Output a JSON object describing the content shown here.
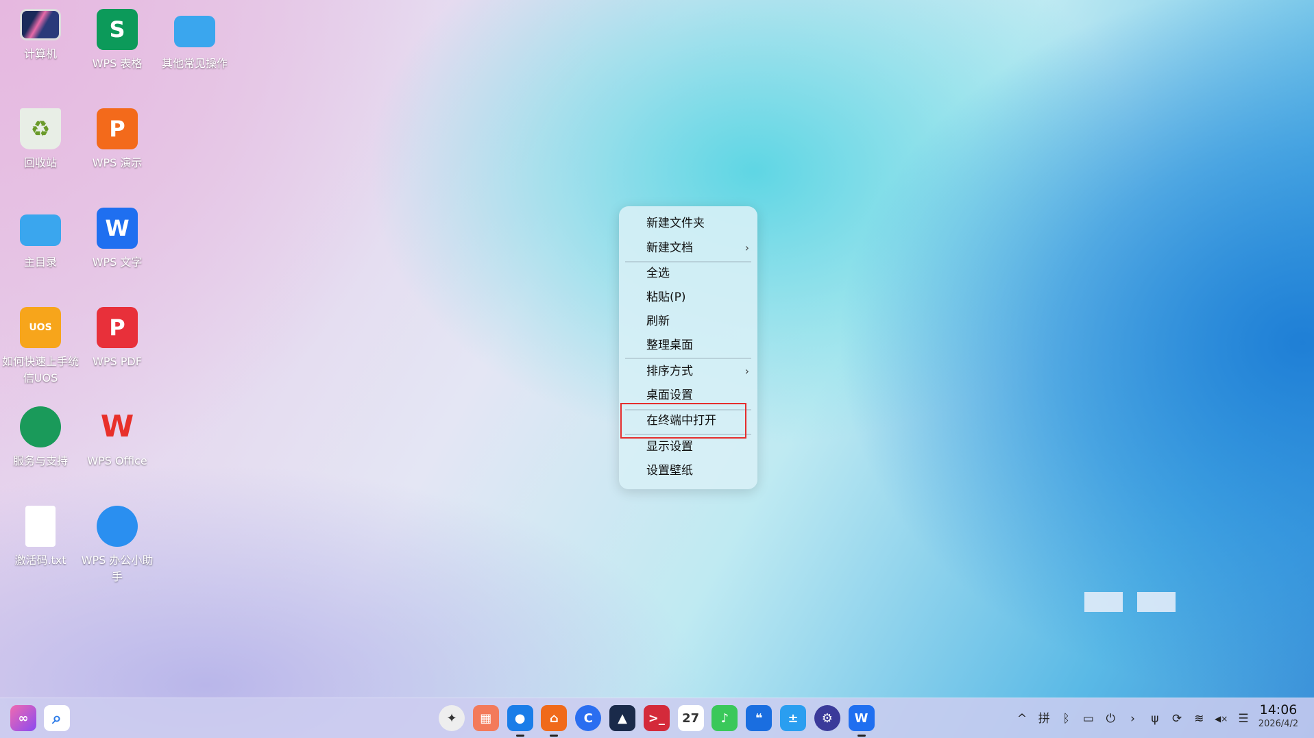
{
  "desktop_icons": [
    {
      "label": "计算机",
      "icon": "computer-icon",
      "color": "#2b3a7a"
    },
    {
      "label": "WPS 表格",
      "icon": "wps-spreadsheet-icon",
      "glyph": "S",
      "color": "#0c9a5a"
    },
    {
      "label": "其他常见操作",
      "icon": "folder-icon",
      "color": "#3aa6ee"
    },
    {
      "label": "回收站",
      "icon": "trash-icon",
      "color": "#e8eee6"
    },
    {
      "label": "WPS 演示",
      "icon": "wps-presentation-icon",
      "glyph": "P",
      "color": "#f36a1b"
    },
    {
      "label": "主目录",
      "icon": "home-folder-icon",
      "color": "#3aa6ee"
    },
    {
      "label": "WPS 文字",
      "icon": "wps-writer-icon",
      "glyph": "W",
      "color": "#1f6ff0"
    },
    {
      "label": "如何快速上手统信UOS",
      "icon": "uos-guide-icon",
      "glyph": "UOS",
      "color": "#f7a51b"
    },
    {
      "label": "WPS PDF",
      "icon": "wps-pdf-icon",
      "glyph": "P",
      "color": "#e8303a"
    },
    {
      "label": "服务与支持",
      "icon": "support-icon",
      "color": "#1a9a5a"
    },
    {
      "label": "WPS Office",
      "icon": "wps-office-icon",
      "glyph": "W",
      "color": "#e8302a"
    },
    {
      "label": "激活码.txt",
      "icon": "text-file-icon",
      "color": "#ffffff"
    },
    {
      "label": "WPS 办公小助手",
      "icon": "wps-assistant-icon",
      "color": "#2a8ff0"
    }
  ],
  "context_menu": {
    "items": [
      {
        "label": "新建文件夹"
      },
      {
        "label": "新建文档",
        "submenu": "›"
      },
      {
        "label": "全选"
      },
      {
        "label": "粘贴(P)"
      },
      {
        "label": "刷新"
      },
      {
        "label": "整理桌面"
      },
      {
        "label": "排序方式",
        "submenu": "›"
      },
      {
        "label": "桌面设置"
      },
      {
        "label": "在终端中打开"
      },
      {
        "label": "显示设置"
      },
      {
        "label": "设置壁纸"
      }
    ],
    "highlight_color": "#e52d2d"
  },
  "taskbar": {
    "left": [
      {
        "icon": "launcher-icon",
        "color": "#c04ae8"
      },
      {
        "icon": "search-icon",
        "color": "#ffffff"
      }
    ],
    "dock": [
      {
        "icon": "launcher-grid-icon",
        "color": "#eeeeee",
        "glyph": "✦"
      },
      {
        "icon": "multitask-view-icon",
        "color": "#f37a5a",
        "glyph": "▦"
      },
      {
        "icon": "file-manager-icon",
        "color": "#1a7de8",
        "glyph": "●",
        "running": true
      },
      {
        "icon": "app-store-icon",
        "color": "#f06a1a",
        "glyph": "⌂",
        "running": true
      },
      {
        "icon": "browser-icon",
        "color": "#2a6ef0",
        "glyph": "C"
      },
      {
        "icon": "mail-icon",
        "color": "#1a2a4a",
        "glyph": "▲"
      },
      {
        "icon": "terminal-icon",
        "color": "#d42a3a",
        "glyph": ">_"
      },
      {
        "icon": "calendar-icon",
        "color": "#ffffff",
        "glyph": "27"
      },
      {
        "icon": "music-icon",
        "color": "#3ac85a",
        "glyph": "♪"
      },
      {
        "icon": "notes-icon",
        "color": "#1a6ee0",
        "glyph": "❝"
      },
      {
        "icon": "calculator-icon",
        "color": "#2a9ef0",
        "glyph": "±"
      },
      {
        "icon": "settings-icon",
        "color": "#3a3a9a",
        "glyph": "⚙"
      },
      {
        "icon": "wps-writer-icon",
        "color": "#1f6ff0",
        "glyph": "W",
        "running": true
      }
    ],
    "tray": [
      {
        "icon": "chevron-up-icon",
        "glyph": "^"
      },
      {
        "icon": "input-method-icon",
        "glyph": "拼"
      },
      {
        "icon": "bluetooth-icon",
        "glyph": "ᛒ"
      },
      {
        "icon": "battery-icon",
        "glyph": "▭"
      },
      {
        "icon": "power-icon",
        "glyph": "⏻"
      },
      {
        "icon": "arrow-circle-icon",
        "glyph": "›"
      },
      {
        "icon": "usb-icon",
        "glyph": "ψ"
      },
      {
        "icon": "sync-icon",
        "glyph": "⟳"
      },
      {
        "icon": "wifi-icon",
        "glyph": "≋"
      },
      {
        "icon": "volume-muted-icon",
        "glyph": "◀×"
      },
      {
        "icon": "control-center-icon",
        "glyph": "☰"
      }
    ],
    "time": "14:06",
    "date": "2026/4/2"
  }
}
